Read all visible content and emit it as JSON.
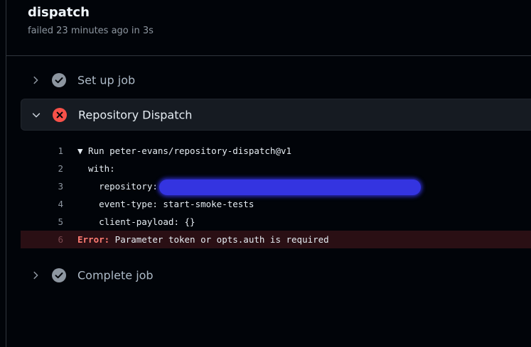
{
  "job": {
    "title": "dispatch",
    "status_text": "failed 23 minutes ago in 3s"
  },
  "steps": [
    {
      "label": "Set up job",
      "status": "success",
      "expanded": false
    },
    {
      "label": "Repository Dispatch",
      "status": "failure",
      "expanded": true
    },
    {
      "label": "Complete job",
      "status": "success",
      "expanded": false
    }
  ],
  "log": {
    "lines": [
      {
        "number": "1",
        "text": "▼ Run peter-evans/repository-dispatch@v1"
      },
      {
        "number": "2",
        "text": "  with:"
      },
      {
        "number": "3",
        "text": "    repository:",
        "redacted": true
      },
      {
        "number": "4",
        "text": "    event-type: start-smoke-tests"
      },
      {
        "number": "5",
        "text": "    client-payload: {}"
      },
      {
        "number": "6",
        "error_label": "Error:",
        "text": " Parameter token or opts.auth is required"
      }
    ]
  },
  "colors": {
    "background": "#010409",
    "success_icon": "#8d96a0",
    "failure_icon": "#f85149",
    "error_text": "#ff7b72",
    "error_row": "#2a0f14"
  }
}
